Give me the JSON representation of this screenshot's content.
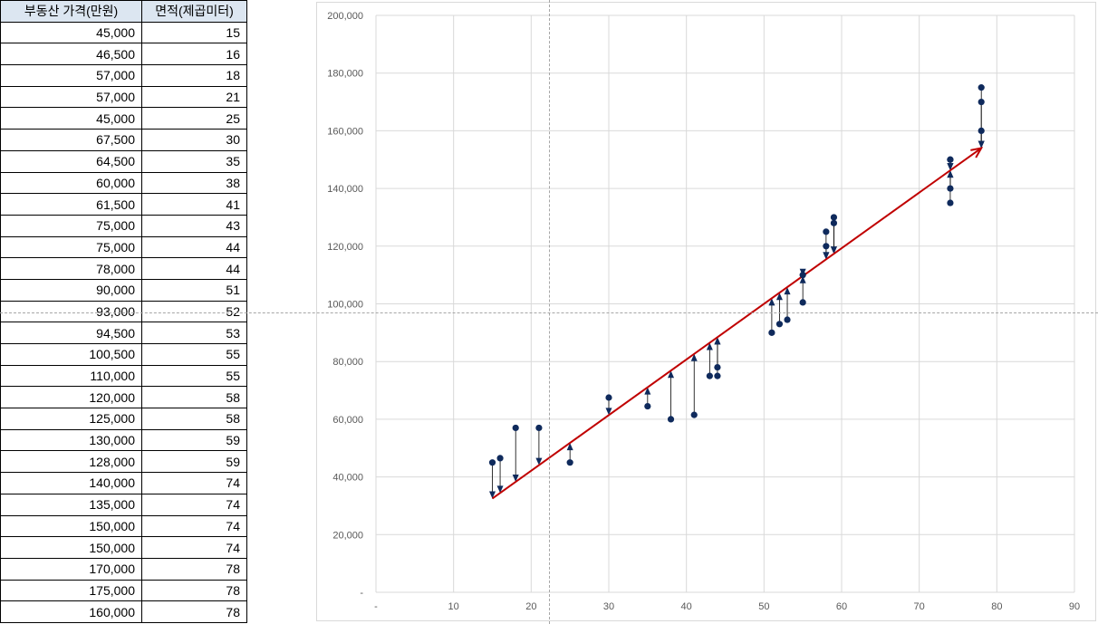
{
  "table": {
    "headers": [
      "부동산 가격(만원)",
      "면적(제곱미터)"
    ],
    "rows": [
      [
        "45,000",
        "15"
      ],
      [
        "46,500",
        "16"
      ],
      [
        "57,000",
        "18"
      ],
      [
        "57,000",
        "21"
      ],
      [
        "45,000",
        "25"
      ],
      [
        "67,500",
        "30"
      ],
      [
        "64,500",
        "35"
      ],
      [
        "60,000",
        "38"
      ],
      [
        "61,500",
        "41"
      ],
      [
        "75,000",
        "43"
      ],
      [
        "75,000",
        "44"
      ],
      [
        "78,000",
        "44"
      ],
      [
        "90,000",
        "51"
      ],
      [
        "93,000",
        "52"
      ],
      [
        "94,500",
        "53"
      ],
      [
        "100,500",
        "55"
      ],
      [
        "110,000",
        "55"
      ],
      [
        "120,000",
        "58"
      ],
      [
        "125,000",
        "58"
      ],
      [
        "130,000",
        "59"
      ],
      [
        "128,000",
        "59"
      ],
      [
        "140,000",
        "74"
      ],
      [
        "135,000",
        "74"
      ],
      [
        "150,000",
        "74"
      ],
      [
        "150,000",
        "74"
      ],
      [
        "170,000",
        "78"
      ],
      [
        "175,000",
        "78"
      ],
      [
        "160,000",
        "78"
      ]
    ]
  },
  "chart_data": {
    "type": "scatter",
    "xlim": [
      0,
      90
    ],
    "ylim": [
      0,
      200000
    ],
    "x_ticks": [
      "-",
      "10",
      "20",
      "30",
      "40",
      "50",
      "60",
      "70",
      "80",
      "90"
    ],
    "y_ticks": [
      "-",
      "20,000",
      "40,000",
      "60,000",
      "80,000",
      "100,000",
      "120,000",
      "140,000",
      "160,000",
      "180,000",
      "200,000"
    ],
    "grid": true,
    "points": [
      {
        "x": 15,
        "y": 45000
      },
      {
        "x": 16,
        "y": 46500
      },
      {
        "x": 18,
        "y": 57000
      },
      {
        "x": 21,
        "y": 57000
      },
      {
        "x": 25,
        "y": 45000
      },
      {
        "x": 30,
        "y": 67500
      },
      {
        "x": 35,
        "y": 64500
      },
      {
        "x": 38,
        "y": 60000
      },
      {
        "x": 41,
        "y": 61500
      },
      {
        "x": 43,
        "y": 75000
      },
      {
        "x": 44,
        "y": 75000
      },
      {
        "x": 44,
        "y": 78000
      },
      {
        "x": 51,
        "y": 90000
      },
      {
        "x": 52,
        "y": 93000
      },
      {
        "x": 53,
        "y": 94500
      },
      {
        "x": 55,
        "y": 100500
      },
      {
        "x": 55,
        "y": 110000
      },
      {
        "x": 58,
        "y": 120000
      },
      {
        "x": 58,
        "y": 125000
      },
      {
        "x": 59,
        "y": 130000
      },
      {
        "x": 59,
        "y": 128000
      },
      {
        "x": 74,
        "y": 140000
      },
      {
        "x": 74,
        "y": 135000
      },
      {
        "x": 74,
        "y": 150000
      },
      {
        "x": 74,
        "y": 150000
      },
      {
        "x": 78,
        "y": 170000
      },
      {
        "x": 78,
        "y": 175000
      },
      {
        "x": 78,
        "y": 160000
      }
    ],
    "trend_line": {
      "x1": 15,
      "y1": 32500,
      "x2": 78,
      "y2": 154000,
      "color": "#c00000"
    },
    "point_color": "#0f2a5c",
    "mean_x": 22,
    "mean_y": 97500
  }
}
